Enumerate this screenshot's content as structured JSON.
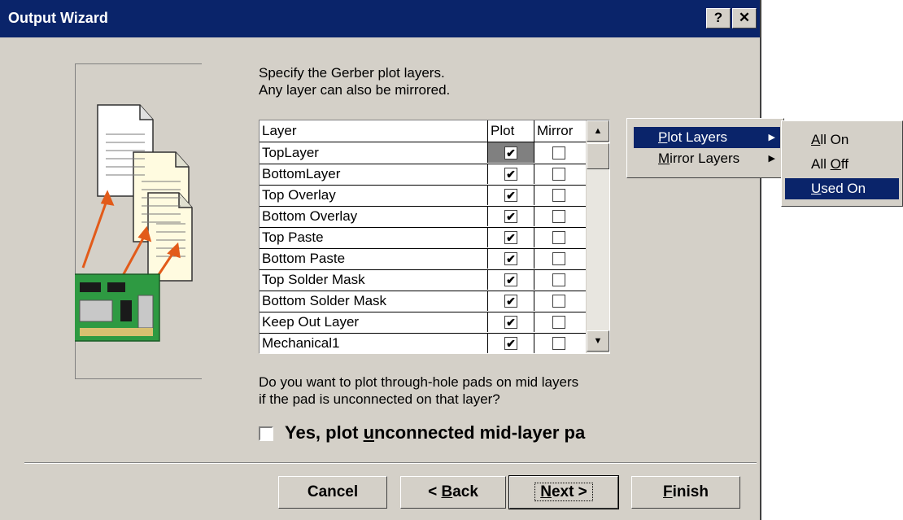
{
  "window": {
    "title": "Output Wizard",
    "help_button": "?",
    "close_button": "✕"
  },
  "instructions": {
    "line1": "Specify the Gerber plot layers.",
    "line2": "Any layer can also be mirrored."
  },
  "layer_table": {
    "columns": [
      "Layer",
      "Plot",
      "Mirror"
    ],
    "rows": [
      {
        "layer": "TopLayer",
        "plot": true,
        "mirror": false
      },
      {
        "layer": "BottomLayer",
        "plot": true,
        "mirror": false
      },
      {
        "layer": "Top Overlay",
        "plot": true,
        "mirror": false
      },
      {
        "layer": "Bottom Overlay",
        "plot": true,
        "mirror": false
      },
      {
        "layer": "Top Paste",
        "plot": true,
        "mirror": false
      },
      {
        "layer": "Bottom Paste",
        "plot": true,
        "mirror": false
      },
      {
        "layer": "Top Solder Mask",
        "plot": true,
        "mirror": false
      },
      {
        "layer": "Bottom Solder Mask",
        "plot": true,
        "mirror": false
      },
      {
        "layer": "Keep Out Layer",
        "plot": true,
        "mirror": false
      },
      {
        "layer": "Mechanical1",
        "plot": true,
        "mirror": false
      }
    ],
    "check_glyph": "✔"
  },
  "question": {
    "line1": "Do you want to plot through-hole pads on mid layers",
    "line2": "if the pad is unconnected on that layer?"
  },
  "mid_layer_checkbox": {
    "label_prefix": "Yes, plot ",
    "label_mnemonic": "u",
    "label_suffix": "nconnected mid-layer pa",
    "checked": false
  },
  "buttons": {
    "cancel": "Cancel",
    "back_prefix": "< ",
    "back_mnemonic": "B",
    "back_suffix": "ack",
    "next_mnemonic": "N",
    "next_suffix": "ext >",
    "finish_mnemonic": "F",
    "finish_suffix": "inish"
  },
  "context_menu": {
    "items": [
      {
        "mnemonic": "P",
        "rest": "lot Layers",
        "selected": true
      },
      {
        "mnemonic": "M",
        "rest": "irror Layers",
        "selected": false
      }
    ],
    "submenu_arrow": "▶"
  },
  "submenu": {
    "items": [
      {
        "pre": "",
        "mnemonic": "A",
        "rest": "ll On",
        "selected": false
      },
      {
        "pre": "All ",
        "mnemonic": "O",
        "rest": "ff",
        "selected": false
      },
      {
        "pre": "",
        "mnemonic": "U",
        "rest": "sed On",
        "selected": true
      }
    ]
  },
  "scrollbar": {
    "up_arrow": "▲",
    "down_arrow": "▼"
  },
  "colors": {
    "titlebar": "#0a246a",
    "dialog_face": "#d4d0c8",
    "menu_highlight": "#0a246a",
    "illustration_teal": "#2f7f86"
  },
  "icons": [
    "pcb-board-illustration",
    "document-pages-illustration"
  ]
}
